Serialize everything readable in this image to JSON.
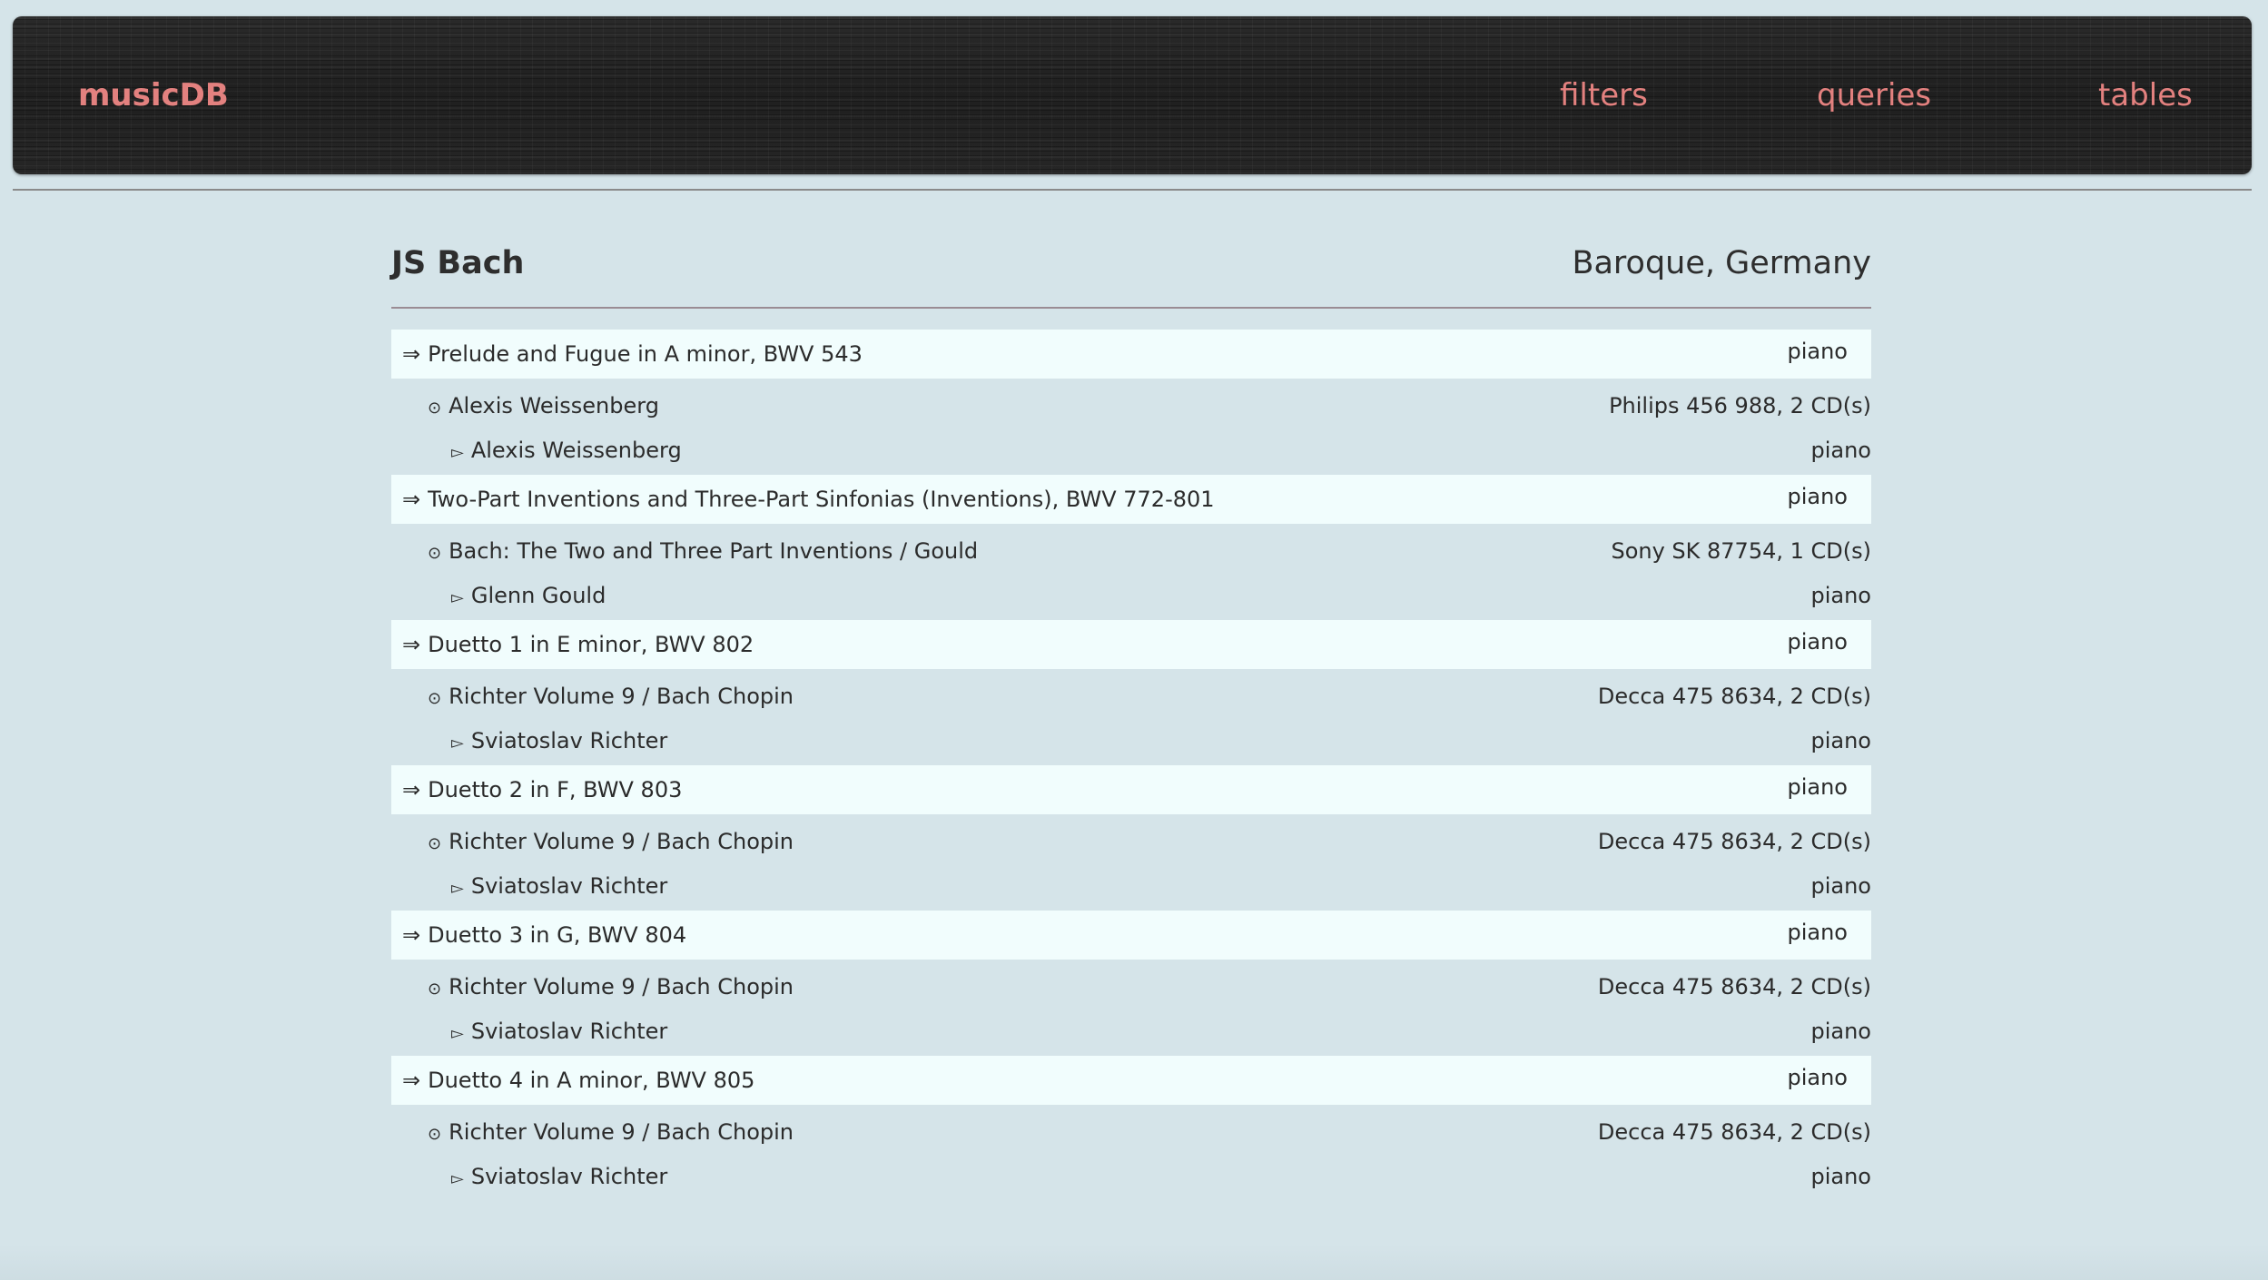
{
  "app": {
    "brand": "musicDB",
    "nav": [
      {
        "label": "filters"
      },
      {
        "label": "queries"
      },
      {
        "label": "tables"
      }
    ]
  },
  "composer": {
    "name": "JS Bach",
    "meta": "Baroque, Germany"
  },
  "icons": {
    "work": "⇒",
    "recording": "⊙",
    "performer": "▻"
  },
  "colors": {
    "accent": "#e3817f",
    "page_bg": "#d5e4e9",
    "work_row_bg": "#f1fdfd",
    "topbar_bg": "#232323"
  },
  "works": [
    {
      "title": "Prelude and Fugue in A minor, BWV 543",
      "instrument": "piano",
      "recording": {
        "title": "Alexis Weissenberg",
        "label": "Philips 456 988, 2 CD(s)"
      },
      "performer": {
        "name": "Alexis Weissenberg",
        "instrument": "piano"
      }
    },
    {
      "title": "Two-Part Inventions and Three-Part Sinfonias (Inventions), BWV 772-801",
      "instrument": "piano",
      "recording": {
        "title": "Bach: The Two and Three Part Inventions / Gould",
        "label": "Sony SK 87754, 1 CD(s)"
      },
      "performer": {
        "name": "Glenn Gould",
        "instrument": "piano"
      }
    },
    {
      "title": "Duetto 1 in E minor, BWV 802",
      "instrument": "piano",
      "recording": {
        "title": "Richter Volume 9 / Bach Chopin",
        "label": "Decca 475 8634, 2 CD(s)"
      },
      "performer": {
        "name": "Sviatoslav Richter",
        "instrument": "piano"
      }
    },
    {
      "title": "Duetto 2 in F, BWV 803",
      "instrument": "piano",
      "recording": {
        "title": "Richter Volume 9 / Bach Chopin",
        "label": "Decca 475 8634, 2 CD(s)"
      },
      "performer": {
        "name": "Sviatoslav Richter",
        "instrument": "piano"
      }
    },
    {
      "title": "Duetto 3 in G, BWV 804",
      "instrument": "piano",
      "recording": {
        "title": "Richter Volume 9 / Bach Chopin",
        "label": "Decca 475 8634, 2 CD(s)"
      },
      "performer": {
        "name": "Sviatoslav Richter",
        "instrument": "piano"
      }
    },
    {
      "title": "Duetto 4 in A minor, BWV 805",
      "instrument": "piano",
      "recording": {
        "title": "Richter Volume 9 / Bach Chopin",
        "label": "Decca 475 8634, 2 CD(s)"
      },
      "performer": {
        "name": "Sviatoslav Richter",
        "instrument": "piano"
      }
    }
  ]
}
